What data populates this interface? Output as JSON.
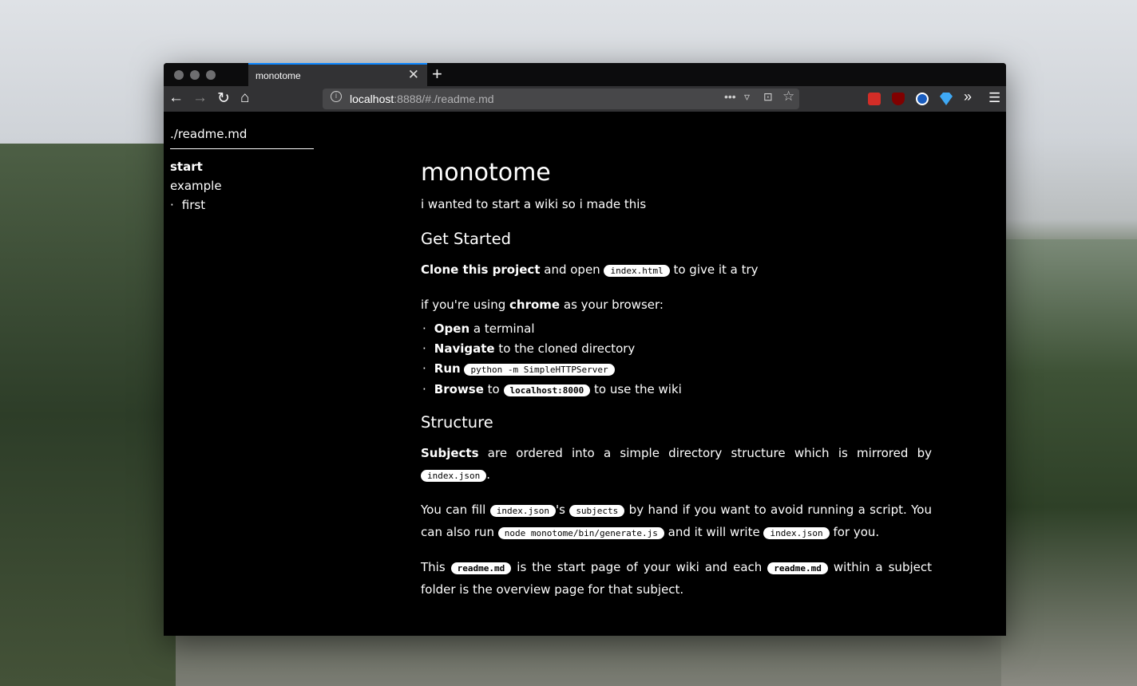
{
  "browser": {
    "tab_title": "monotome",
    "url_host": "localhost",
    "url_rest": ":8888/#./readme.md",
    "ext_colors": {
      "lastpass": "#d32d27",
      "ublock": "#800000",
      "s": "#1a5dbf",
      "gem": "#3fa9f5",
      "accent": "#0a84ff"
    }
  },
  "sidebar": {
    "title": "./readme.md",
    "items": [
      {
        "label": "start"
      },
      {
        "label": "example"
      },
      {
        "label": "first"
      }
    ]
  },
  "main": {
    "title": "monotome",
    "intro": "i wanted to start a wiki so i made this",
    "h_get_started": "Get Started",
    "p1": {
      "b": "Clone this project",
      "t1": " and open ",
      "c": "index.html",
      "t2": " to give it a try"
    },
    "p2": {
      "t1": "if you're using ",
      "b": "chrome",
      "t2": " as your browser:"
    },
    "steps": [
      {
        "b": "Open",
        "t": " a terminal"
      },
      {
        "b": "Navigate",
        "t": " to the cloned directory"
      },
      {
        "b": "Run",
        "t": " ",
        "c": "python -m SimpleHTTPServer"
      },
      {
        "b": "Browse",
        "t": " to ",
        "c": "localhost:8000",
        "t2": " to use the wiki"
      }
    ],
    "h_structure": "Structure",
    "p3": {
      "b": "Subjects",
      "t1": " are ordered into a simple directory structure which is mirrored by ",
      "c": "index.json",
      "t2": "."
    },
    "p4": {
      "t1": "You can fill ",
      "c1": "index.json",
      "t2": "'s ",
      "c2": "subjects",
      "t3": " by hand if you want to avoid running a script. You can also run ",
      "c3": "node monotome/bin/generate.js",
      "t4": " and it will write ",
      "c4": "index.json",
      "t5": " for you."
    },
    "p5": {
      "t1": "This ",
      "c1": "readme.md",
      "t2": " is the start page of your wiki and each ",
      "c2": "readme.md",
      "t3": " within a subject folder is the overview page for that subject."
    }
  }
}
